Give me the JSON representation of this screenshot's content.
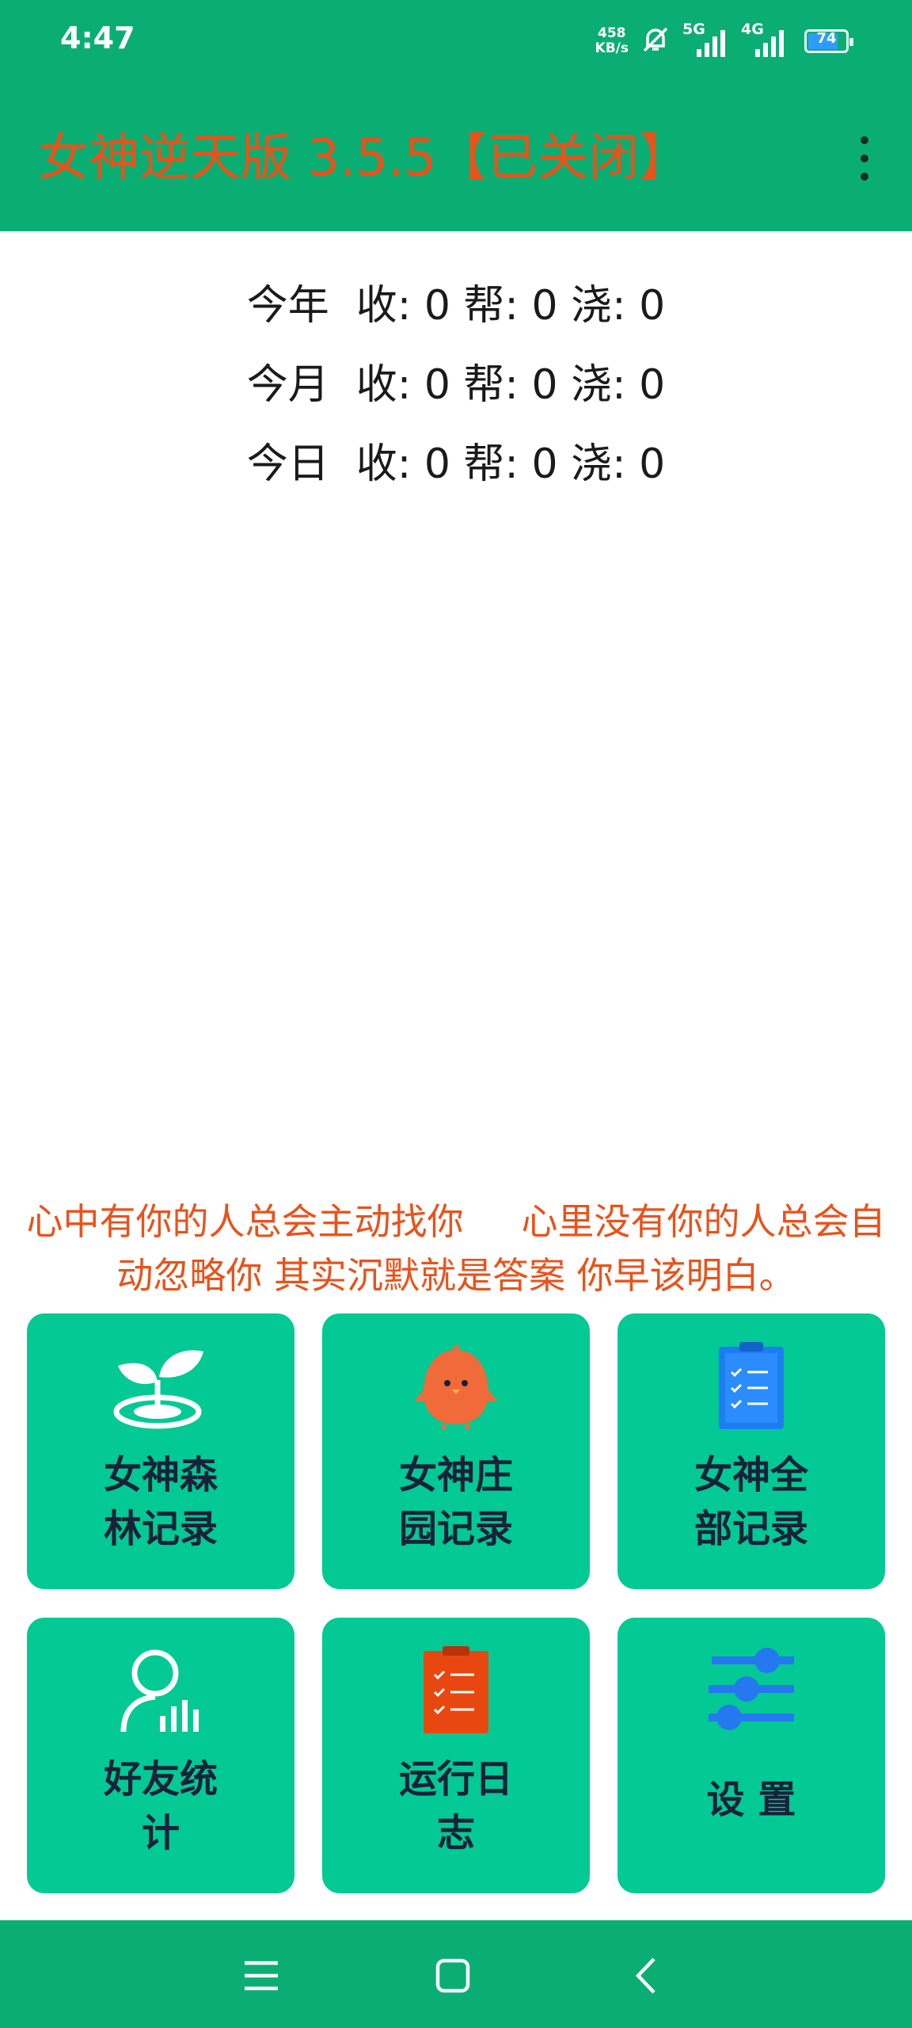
{
  "status": {
    "time": "4:47",
    "speed_value": "458",
    "speed_unit": "KB/s",
    "signal1": "5G",
    "signal2": "4G",
    "battery": "74",
    "icons": [
      "mute-bell-icon",
      "signal-5g-icon",
      "signal-4g-icon",
      "battery-icon"
    ]
  },
  "app_bar": {
    "title": "女神逆天版 3.5.5【已关闭】",
    "menu_icon": "more-vert-icon"
  },
  "stats": {
    "rows": [
      {
        "period": "今年",
        "text": "收: 0 帮: 0 浇: 0"
      },
      {
        "period": "今月",
        "text": "收: 0 帮: 0 浇: 0"
      },
      {
        "period": "今日",
        "text": "收: 0 帮: 0 浇: 0"
      }
    ]
  },
  "quote": "心中有你的人总会主动找你     心里没有你的人总会自动忽略你 其实沉默就是答案 你早该明白。",
  "tiles": [
    {
      "label": "女神森林记录",
      "icon": "sprout-icon"
    },
    {
      "label": "女神庄园记录",
      "icon": "chick-icon"
    },
    {
      "label": "女神全部记录",
      "icon": "clipboard-checklist-icon"
    },
    {
      "label": "好友统计",
      "icon": "user-stats-icon"
    },
    {
      "label": "运行日志",
      "icon": "log-clipboard-icon"
    },
    {
      "label": "设 置",
      "icon": "settings-sliders-icon"
    }
  ],
  "colors": {
    "primary": "#0aae73",
    "tile": "#03c994",
    "accent": "#e9521a",
    "text_dark": "#17223a"
  },
  "nav": {
    "icons": [
      "menu-icon",
      "home-square-icon",
      "back-chevron-icon"
    ]
  }
}
